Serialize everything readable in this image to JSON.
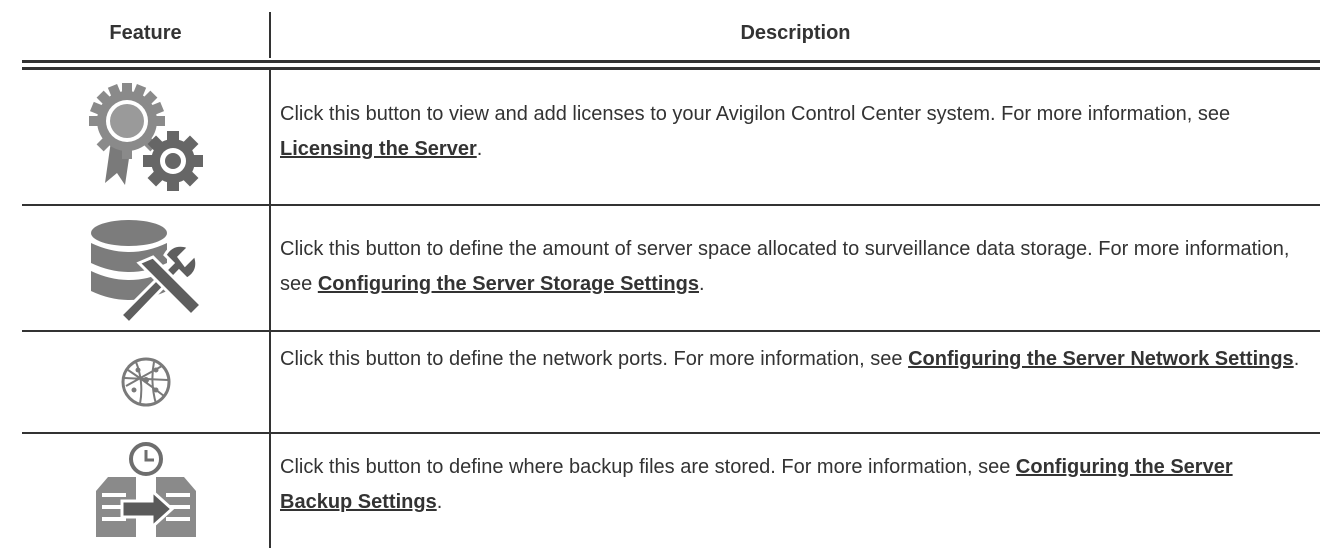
{
  "header": {
    "feature": "Feature",
    "description": "Description"
  },
  "rows": [
    {
      "icon": "license-gears-icon",
      "text_before": "Click this button to view and add licenses to your Avigilon Control Center system. For more information, see ",
      "link": "Licensing the Server",
      "text_after": "."
    },
    {
      "icon": "storage-wrench-icon",
      "text_before": "Click this button to define the amount of server space allocated to surveillance data storage. For more information, see ",
      "link": "Configuring the Server Storage Settings",
      "text_after": "."
    },
    {
      "icon": "network-globe-icon",
      "text_before": "Click this button to define the network ports. For more information, see ",
      "link": "Configuring the Server Network Settings",
      "text_after": "."
    },
    {
      "icon": "backup-clock-icon",
      "text_before": "Click this button to define where backup files are stored. For more information, see ",
      "link": "Configuring the Server Backup Settings",
      "text_after": "."
    }
  ]
}
